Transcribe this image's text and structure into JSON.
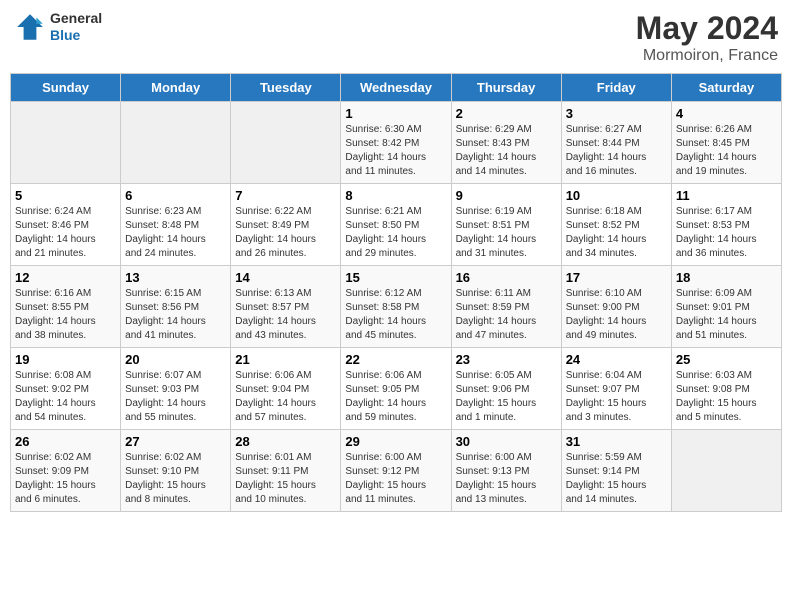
{
  "header": {
    "logo_general": "General",
    "logo_blue": "Blue",
    "month_year": "May 2024",
    "location": "Mormoiron, France"
  },
  "days_of_week": [
    "Sunday",
    "Monday",
    "Tuesday",
    "Wednesday",
    "Thursday",
    "Friday",
    "Saturday"
  ],
  "weeks": [
    [
      {
        "day": "",
        "content": ""
      },
      {
        "day": "",
        "content": ""
      },
      {
        "day": "",
        "content": ""
      },
      {
        "day": "1",
        "content": "Sunrise: 6:30 AM\nSunset: 8:42 PM\nDaylight: 14 hours\nand 11 minutes."
      },
      {
        "day": "2",
        "content": "Sunrise: 6:29 AM\nSunset: 8:43 PM\nDaylight: 14 hours\nand 14 minutes."
      },
      {
        "day": "3",
        "content": "Sunrise: 6:27 AM\nSunset: 8:44 PM\nDaylight: 14 hours\nand 16 minutes."
      },
      {
        "day": "4",
        "content": "Sunrise: 6:26 AM\nSunset: 8:45 PM\nDaylight: 14 hours\nand 19 minutes."
      }
    ],
    [
      {
        "day": "5",
        "content": "Sunrise: 6:24 AM\nSunset: 8:46 PM\nDaylight: 14 hours\nand 21 minutes."
      },
      {
        "day": "6",
        "content": "Sunrise: 6:23 AM\nSunset: 8:48 PM\nDaylight: 14 hours\nand 24 minutes."
      },
      {
        "day": "7",
        "content": "Sunrise: 6:22 AM\nSunset: 8:49 PM\nDaylight: 14 hours\nand 26 minutes."
      },
      {
        "day": "8",
        "content": "Sunrise: 6:21 AM\nSunset: 8:50 PM\nDaylight: 14 hours\nand 29 minutes."
      },
      {
        "day": "9",
        "content": "Sunrise: 6:19 AM\nSunset: 8:51 PM\nDaylight: 14 hours\nand 31 minutes."
      },
      {
        "day": "10",
        "content": "Sunrise: 6:18 AM\nSunset: 8:52 PM\nDaylight: 14 hours\nand 34 minutes."
      },
      {
        "day": "11",
        "content": "Sunrise: 6:17 AM\nSunset: 8:53 PM\nDaylight: 14 hours\nand 36 minutes."
      }
    ],
    [
      {
        "day": "12",
        "content": "Sunrise: 6:16 AM\nSunset: 8:55 PM\nDaylight: 14 hours\nand 38 minutes."
      },
      {
        "day": "13",
        "content": "Sunrise: 6:15 AM\nSunset: 8:56 PM\nDaylight: 14 hours\nand 41 minutes."
      },
      {
        "day": "14",
        "content": "Sunrise: 6:13 AM\nSunset: 8:57 PM\nDaylight: 14 hours\nand 43 minutes."
      },
      {
        "day": "15",
        "content": "Sunrise: 6:12 AM\nSunset: 8:58 PM\nDaylight: 14 hours\nand 45 minutes."
      },
      {
        "day": "16",
        "content": "Sunrise: 6:11 AM\nSunset: 8:59 PM\nDaylight: 14 hours\nand 47 minutes."
      },
      {
        "day": "17",
        "content": "Sunrise: 6:10 AM\nSunset: 9:00 PM\nDaylight: 14 hours\nand 49 minutes."
      },
      {
        "day": "18",
        "content": "Sunrise: 6:09 AM\nSunset: 9:01 PM\nDaylight: 14 hours\nand 51 minutes."
      }
    ],
    [
      {
        "day": "19",
        "content": "Sunrise: 6:08 AM\nSunset: 9:02 PM\nDaylight: 14 hours\nand 54 minutes."
      },
      {
        "day": "20",
        "content": "Sunrise: 6:07 AM\nSunset: 9:03 PM\nDaylight: 14 hours\nand 55 minutes."
      },
      {
        "day": "21",
        "content": "Sunrise: 6:06 AM\nSunset: 9:04 PM\nDaylight: 14 hours\nand 57 minutes."
      },
      {
        "day": "22",
        "content": "Sunrise: 6:06 AM\nSunset: 9:05 PM\nDaylight: 14 hours\nand 59 minutes."
      },
      {
        "day": "23",
        "content": "Sunrise: 6:05 AM\nSunset: 9:06 PM\nDaylight: 15 hours\nand 1 minute."
      },
      {
        "day": "24",
        "content": "Sunrise: 6:04 AM\nSunset: 9:07 PM\nDaylight: 15 hours\nand 3 minutes."
      },
      {
        "day": "25",
        "content": "Sunrise: 6:03 AM\nSunset: 9:08 PM\nDaylight: 15 hours\nand 5 minutes."
      }
    ],
    [
      {
        "day": "26",
        "content": "Sunrise: 6:02 AM\nSunset: 9:09 PM\nDaylight: 15 hours\nand 6 minutes."
      },
      {
        "day": "27",
        "content": "Sunrise: 6:02 AM\nSunset: 9:10 PM\nDaylight: 15 hours\nand 8 minutes."
      },
      {
        "day": "28",
        "content": "Sunrise: 6:01 AM\nSunset: 9:11 PM\nDaylight: 15 hours\nand 10 minutes."
      },
      {
        "day": "29",
        "content": "Sunrise: 6:00 AM\nSunset: 9:12 PM\nDaylight: 15 hours\nand 11 minutes."
      },
      {
        "day": "30",
        "content": "Sunrise: 6:00 AM\nSunset: 9:13 PM\nDaylight: 15 hours\nand 13 minutes."
      },
      {
        "day": "31",
        "content": "Sunrise: 5:59 AM\nSunset: 9:14 PM\nDaylight: 15 hours\nand 14 minutes."
      },
      {
        "day": "",
        "content": ""
      }
    ]
  ]
}
